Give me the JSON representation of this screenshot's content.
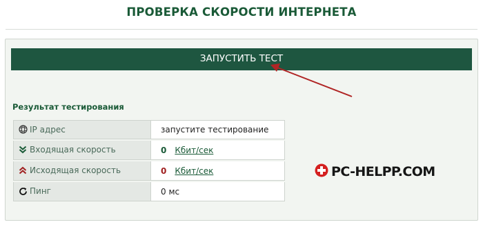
{
  "header": {
    "title": "ПРОВЕРКА СКОРОСТИ ИНТЕРНЕТА"
  },
  "test": {
    "run_button_label": "ЗАПУСТИТЬ ТЕСТ"
  },
  "results": {
    "title": "Результат тестирования",
    "rows": [
      {
        "icon": "globe-icon",
        "label": "IP адрес",
        "value": "запустите тестирование"
      },
      {
        "icon": "download-chevron-icon",
        "label": "Входящая скорость",
        "value": "0",
        "unit": "Кбит/сек"
      },
      {
        "icon": "upload-chevron-icon",
        "label": "Исходящая скорость",
        "value": "0",
        "unit": "Кбит/сек"
      },
      {
        "icon": "refresh-icon",
        "label": "Пинг",
        "value": "0 мс"
      }
    ]
  },
  "watermark": {
    "text": "PC-HELPP.COM"
  },
  "colors": {
    "brand_green": "#1a5a37",
    "button_bg": "#1e5640",
    "panel_bg": "#f2f5f1",
    "upload_red": "#a02020",
    "arrow_red": "#b02525"
  }
}
